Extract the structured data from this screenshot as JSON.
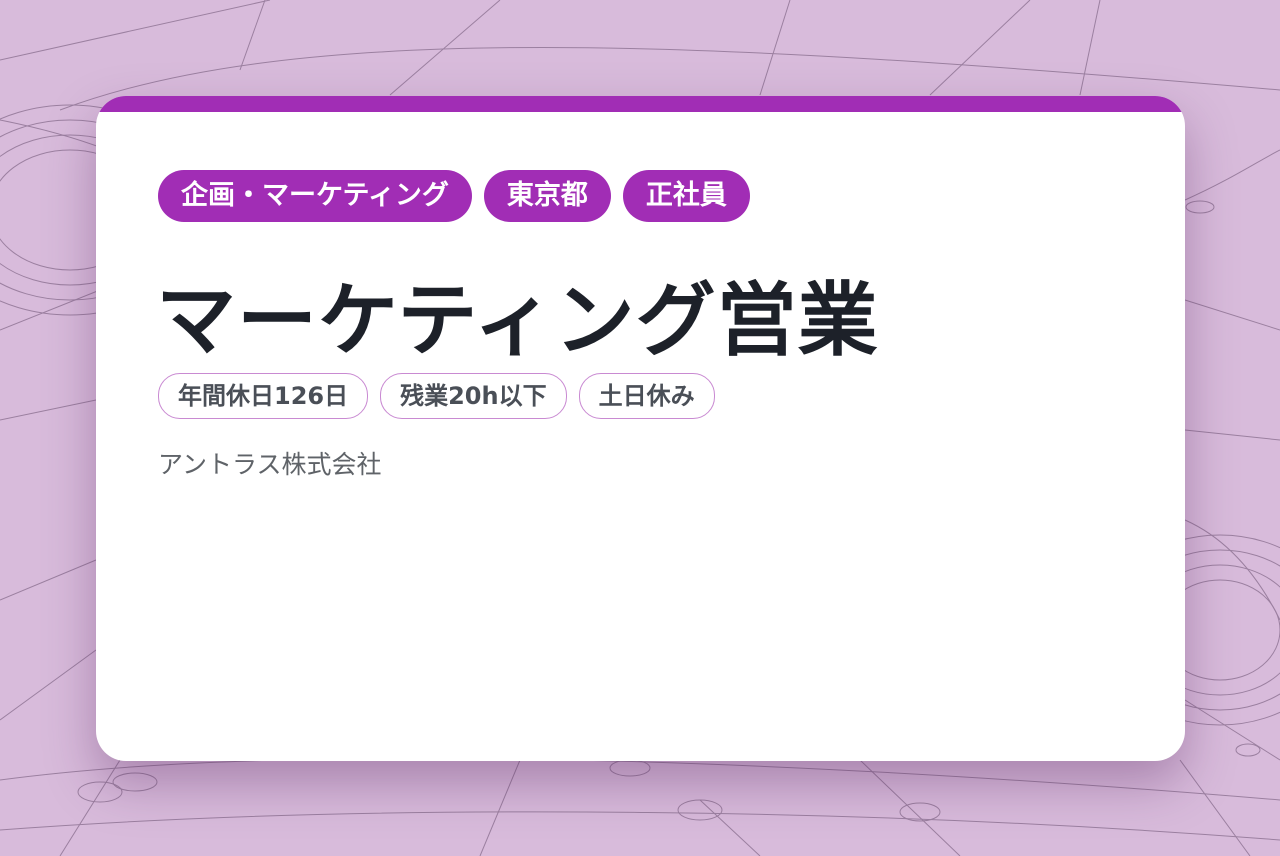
{
  "colors": {
    "background": "#d8bbdb",
    "accent": "#a12db5",
    "title_text": "#1d2129",
    "muted_text": "#5f6368",
    "feature_border": "#c98ad2"
  },
  "job": {
    "category_tags": [
      "企画・マーケティング",
      "東京都",
      "正社員"
    ],
    "title": "マーケティング営業",
    "feature_tags": [
      "年間休日126日",
      "残業20h以下",
      "土日休み"
    ],
    "company": "アントラス株式会社"
  }
}
